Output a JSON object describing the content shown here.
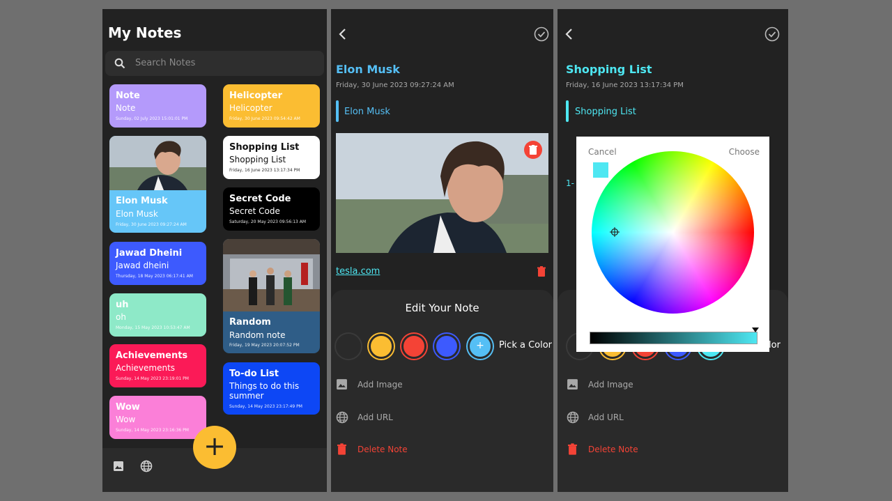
{
  "home": {
    "title": "My Notes",
    "search_placeholder": "Search Notes",
    "notes": [
      {
        "title": "Note",
        "subtitle": "Note",
        "date": "Sunday, 02 July 2023 15:01:01 PM",
        "color": "#b49afb"
      },
      {
        "title": "Elon Musk",
        "subtitle": "Elon Musk",
        "date": "Friday, 30 June 2023 09:27:24 AM",
        "color": "#66c6f8"
      },
      {
        "title": "Jawad Dheini",
        "subtitle": "Jawad dheini",
        "date": "Thursday, 18 May 2023 06:17:41 AM",
        "color": "#3d5afe"
      },
      {
        "title": "uh",
        "subtitle": "oh",
        "date": "Monday, 15 May 2023 10:53:47 AM",
        "color": "#8ee9c8"
      },
      {
        "title": "Achievements",
        "subtitle": "Achievements",
        "date": "Sunday, 14 May 2023 23:19:01 PM",
        "color": "#fb1a57"
      },
      {
        "title": "Wow",
        "subtitle": "Wow",
        "date": "Sunday, 14 May 2023 23:16:36 PM",
        "color": "#fb7fd8"
      },
      {
        "title": "Helicopter",
        "subtitle": "Helicopter",
        "date": "Friday, 30 June 2023 09:54:42 AM",
        "color": "#fbbd32"
      },
      {
        "title": "Shopping List",
        "subtitle": "Shopping List",
        "date": "Friday, 16 June 2023 13:17:34 PM",
        "color": "#ffffff"
      },
      {
        "title": "Secret Code",
        "subtitle": "Secret Code",
        "date": "Saturday, 20 May 2023 09:56:13 AM",
        "color": "#000000"
      },
      {
        "title": "Random",
        "subtitle": "Random note",
        "date": "Friday, 19 May 2023 20:07:52 PM",
        "color": "#2f5d87"
      },
      {
        "title": "To-do List",
        "subtitle": "Things to do this summer",
        "date": "Sunday, 14 May 2023 23:17:49 PM",
        "color": "#0d47f5"
      }
    ],
    "fab_label": "+",
    "bottom_icons": [
      "image-icon",
      "globe-icon"
    ]
  },
  "note_view": {
    "title": "Elon Musk",
    "date": "Friday, 30 June 2023 09:27:24 AM",
    "subtitle": "Elon Musk",
    "accent": "#55bff5",
    "url": "tesla.com",
    "sheet_title": "Edit Your Note",
    "colors": [
      "#2a2a2a",
      "#fbbd32",
      "#f44336",
      "#3d5afe",
      "#55bff5"
    ],
    "pick_color_label": "Pick a Color",
    "options": [
      {
        "label": "Add Image",
        "icon": "image-icon"
      },
      {
        "label": "Add URL",
        "icon": "globe-icon"
      },
      {
        "label": "Delete Note",
        "icon": "trash-icon"
      }
    ]
  },
  "note_edit": {
    "title": "Shopping List",
    "date": "Friday, 16 June 2023 13:17:34 PM",
    "subtitle": "Shopping List",
    "accent": "#4ee7f2",
    "content_partial": "1-",
    "pick_color_partial": "lor",
    "picker": {
      "cancel": "Cancel",
      "choose": "Choose",
      "selected_color": "#4ee7f2"
    },
    "options": [
      {
        "label": "Add Image",
        "icon": "image-icon"
      },
      {
        "label": "Add URL",
        "icon": "globe-icon"
      },
      {
        "label": "Delete Note",
        "icon": "trash-icon"
      }
    ]
  }
}
